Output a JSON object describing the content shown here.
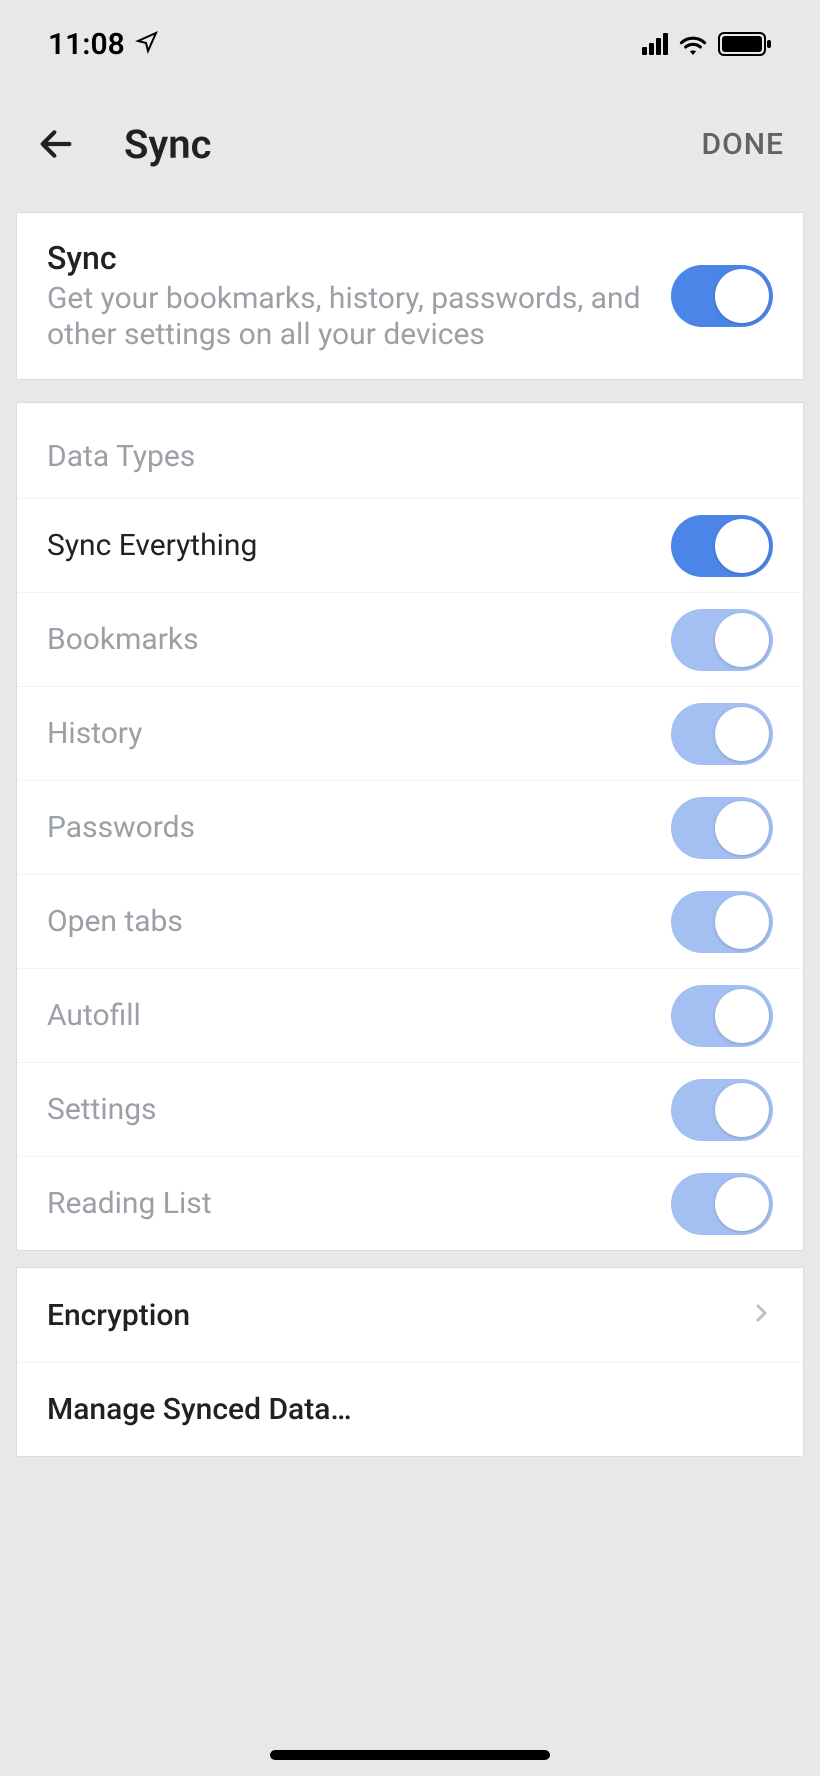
{
  "status": {
    "time": "11:08"
  },
  "header": {
    "title": "Sync",
    "done": "DONE"
  },
  "syncMaster": {
    "title": "Sync",
    "description": "Get your bookmarks, history, passwords, and other settings on all your devices"
  },
  "dataTypes": {
    "sectionTitle": "Data Types",
    "syncEverything": "Sync Everything",
    "items": [
      "Bookmarks",
      "History",
      "Passwords",
      "Open tabs",
      "Autofill",
      "Settings",
      "Reading List"
    ]
  },
  "bottom": {
    "encryption": "Encryption",
    "manage": "Manage Synced Data…"
  }
}
